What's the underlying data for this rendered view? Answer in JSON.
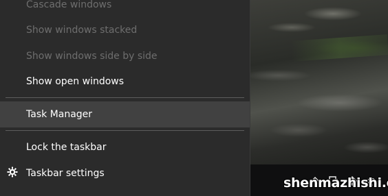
{
  "menu": {
    "items": [
      {
        "label": "Cascade windows",
        "enabled": false
      },
      {
        "label": "Show windows stacked",
        "enabled": false
      },
      {
        "label": "Show windows side by side",
        "enabled": false
      },
      {
        "label": "Show open windows",
        "enabled": true
      },
      {
        "label": "Task Manager",
        "enabled": true,
        "highlighted": true
      },
      {
        "label": "Lock the taskbar",
        "enabled": true
      },
      {
        "label": "Taskbar settings",
        "enabled": true,
        "icon": "gear-icon"
      }
    ]
  },
  "tray": {
    "icons": [
      "chevron-up-icon",
      "battery-icon",
      "network-icon",
      "wifi-icon"
    ]
  },
  "watermark": "shenmazhishi.com",
  "colors": {
    "menu_background": "#2b2b2b",
    "highlight": "#414141",
    "enabled_text": "#ffffff",
    "disabled_text": "#6e6e6e",
    "separator": "#5e5e5e"
  }
}
